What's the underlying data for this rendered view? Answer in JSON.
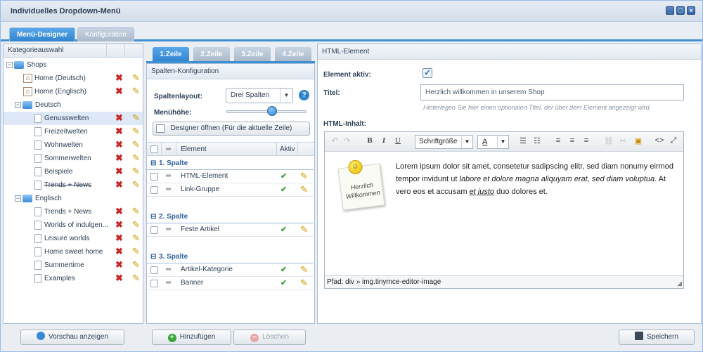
{
  "window": {
    "title": "Individuelles Dropdown-Menü"
  },
  "tabs": {
    "active": "Menü-Designer",
    "inactive": "Konfiguration"
  },
  "left": {
    "header": "Kategorieauswahl",
    "tree": [
      {
        "label": "Shops",
        "type": "folder",
        "level": 0
      },
      {
        "label": "Home (Deutsch)",
        "type": "home",
        "level": 1
      },
      {
        "label": "Home (Englisch)",
        "type": "home",
        "level": 1
      },
      {
        "label": "Deutsch",
        "type": "folder",
        "level": 1
      },
      {
        "label": "Genusswelten",
        "type": "page",
        "level": 2
      },
      {
        "label": "Freizeitwelten",
        "type": "page",
        "level": 2
      },
      {
        "label": "Wohnwelten",
        "type": "page",
        "level": 2
      },
      {
        "label": "Sommerwelten",
        "type": "page",
        "level": 2
      },
      {
        "label": "Beispiele",
        "type": "page",
        "level": 2
      },
      {
        "label": "Trends + News",
        "type": "page",
        "level": 2
      },
      {
        "label": "Englisch",
        "type": "folder",
        "level": 1
      },
      {
        "label": "Trends + News",
        "type": "page",
        "level": 2
      },
      {
        "label": "Worlds of indulgen...",
        "type": "page",
        "level": 2
      },
      {
        "label": "Leisure worlds",
        "type": "page",
        "level": 2
      },
      {
        "label": "Home sweet home",
        "type": "page",
        "level": 2
      },
      {
        "label": "Summertime",
        "type": "page",
        "level": 2
      },
      {
        "label": "Examples",
        "type": "page",
        "level": 2
      }
    ],
    "preview_button": "Vorschau anzeigen"
  },
  "middle": {
    "subtabs": [
      "1.Zeile",
      "2.Zeile",
      "3.Zeile",
      "4.Zeile"
    ],
    "header": "Spalten-Konfiguration",
    "layout_label": "Spaltenlayout:",
    "layout_value": "Drei Spalten",
    "height_label": "Menühöhe:",
    "height_slider_fraction": 0.57,
    "designer_button": "Designer öffnen (Für die aktuelle Zeile)",
    "grid_headers": {
      "element": "Element",
      "active": "Aktiv"
    },
    "groups": [
      {
        "title": "1. Spalte",
        "rows": [
          "HTML-Element",
          "Link-Gruppe"
        ]
      },
      {
        "title": "2. Spalte",
        "rows": [
          "Feste Artikel"
        ]
      },
      {
        "title": "3. Spalte",
        "rows": [
          "Artikel-Kategorie",
          "Banner"
        ]
      }
    ],
    "add_button": "Hinzufügen",
    "delete_button": "Löschen"
  },
  "right": {
    "header": "HTML-Element",
    "active_label": "Element aktiv:",
    "active_checked": true,
    "title_label": "Titel:",
    "title_value": "Herzlich willkommen in unserem Shop",
    "title_hint": "Hinterlegen Sie hier einen optionalen Titel, der über dem Element angezeigt wird.",
    "content_label": "HTML-Inhalt:",
    "font_size_select": "Schriftgröße",
    "note_text": "Herzlich Willkommen",
    "body_plain1": "Lorem ipsum dolor sit amet, consetetur sadipscing elitr, sed diam nonumy eirmod tempor invidunt ut ",
    "body_italic": "labore et dolore magna aliquyam erat, sed diam voluptua.",
    "body_plain2": " At vero eos et accusam ",
    "body_underline": "et justo",
    "body_plain3": " duo dolores et.",
    "path_text": "Pfad: div » img.tinymce-editor-image",
    "save_button": "Speichern"
  },
  "colors": {
    "accent": "#3f8fd3",
    "border": "#a9bed6"
  }
}
